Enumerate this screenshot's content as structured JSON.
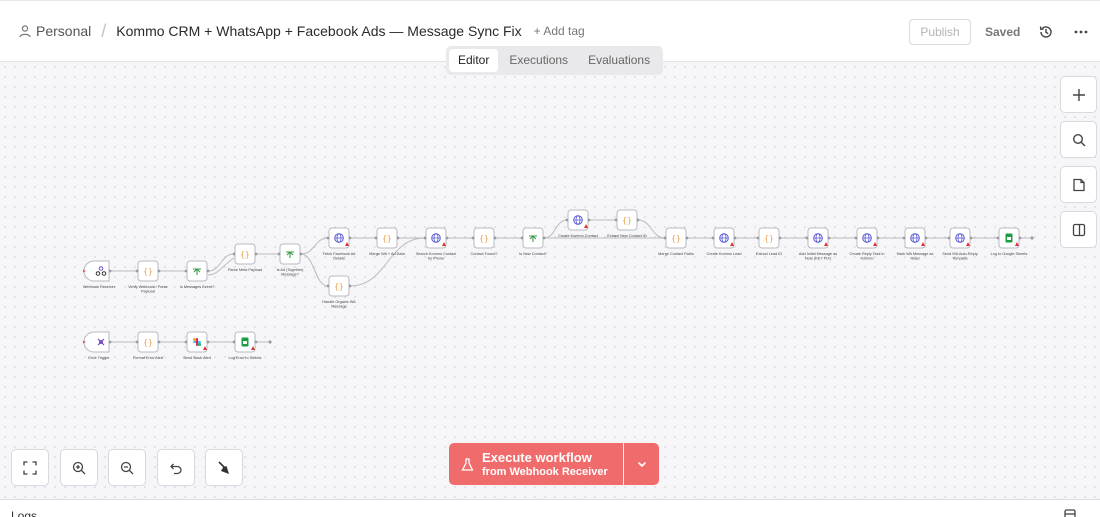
{
  "header": {
    "breadcrumb_owner": "Personal",
    "title": "Kommo CRM + WhatsApp + Facebook Ads — Message Sync Fix",
    "add_tag": "+ Add tag",
    "publish_label": "Publish",
    "saved_label": "Saved"
  },
  "tabs": [
    "Editor",
    "Executions",
    "Evaluations"
  ],
  "execute": {
    "label": "Execute workflow",
    "sub_label": "from Webhook Receiver"
  },
  "logs_label": "Logs",
  "colors": {
    "accent": "#f06b6b",
    "connection": "#b9b9c2",
    "code_node": "#f0a04b",
    "http_node": "#5b5bd6",
    "if_node": "#3c9b4b",
    "sheets_node": "#1e9e43"
  },
  "nodes": [
    {
      "id": "n1",
      "label": "Webhook Receiver",
      "icon": "webhook-icon",
      "trigger": true
    },
    {
      "id": "n2",
      "label": "Verify Webhook / Parse Payload",
      "icon": "code-icon"
    },
    {
      "id": "n3",
      "label": "Is Messages Event?",
      "icon": "if-icon"
    },
    {
      "id": "n4",
      "label": "Parse Meta Payload",
      "icon": "code-icon"
    },
    {
      "id": "n5",
      "label": "Is Ad (Together) Message?",
      "icon": "if-icon"
    },
    {
      "id": "n6",
      "label": "Fetch Facebook Ad Details",
      "icon": "globe-icon"
    },
    {
      "id": "n7",
      "label": "Handle Organic WA Message",
      "icon": "code-icon"
    },
    {
      "id": "n8",
      "label": "Merge WA + Ad Data",
      "icon": "code-icon"
    },
    {
      "id": "n9",
      "label": "Search Kommo Contact by Phone",
      "icon": "globe-icon"
    },
    {
      "id": "n10",
      "label": "Contact Found?",
      "icon": "code-icon"
    },
    {
      "id": "n11",
      "label": "Is New Contact?",
      "icon": "if-icon"
    },
    {
      "id": "n12",
      "label": "Create Kommo Contact",
      "icon": "globe-icon"
    },
    {
      "id": "n13",
      "label": "Extract New Contact ID",
      "icon": "code-icon"
    },
    {
      "id": "n14",
      "label": "Merge Contact Paths",
      "icon": "code-icon"
    },
    {
      "id": "n15",
      "label": "Create Kommo Lead",
      "icon": "globe-icon"
    },
    {
      "id": "n16",
      "label": "Extract Lead ID",
      "icon": "code-icon"
    },
    {
      "id": "n17",
      "label": "Add Initial Message as Note (KEY FIX)",
      "icon": "globe-icon"
    },
    {
      "id": "n18",
      "label": "Create Reply Task in Kommo",
      "icon": "globe-icon"
    },
    {
      "id": "n19",
      "label": "Mark WA Message as Read",
      "icon": "globe-icon"
    },
    {
      "id": "n20",
      "label": "Send WA Auto-Reply Template",
      "icon": "globe-icon"
    },
    {
      "id": "n21",
      "label": "Log to Google Sheets",
      "icon": "sheets-icon"
    },
    {
      "id": "e1",
      "label": "Error Trigger",
      "icon": "error-trigger-icon",
      "trigger": true
    },
    {
      "id": "e2",
      "label": "Format Error Alert",
      "icon": "code-icon"
    },
    {
      "id": "e3",
      "label": "Send Slack Alert",
      "icon": "slack-icon"
    },
    {
      "id": "e4",
      "label": "Log Error to Sheets",
      "icon": "sheets-icon"
    }
  ]
}
